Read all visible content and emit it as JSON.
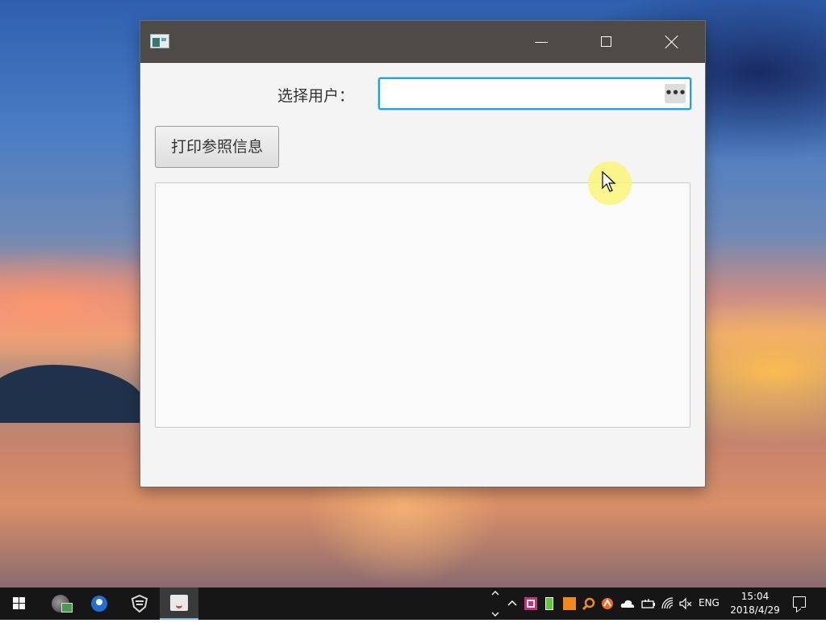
{
  "window": {
    "title": "",
    "controls": {
      "minimize": "minimize",
      "maximize": "maximize",
      "close": "close"
    }
  },
  "form": {
    "user_label": "选择用户：",
    "user_input_value": "",
    "browse_label": "•••",
    "print_button_label": "打印参照信息",
    "output_text": ""
  },
  "taskbar": {
    "language": "ENG",
    "time": "15:04",
    "date": "2018/4/29",
    "pinned_apps": [
      "image-viewer",
      "maps",
      "vpn-shield",
      "java-app"
    ],
    "tray_icons": [
      "show-hidden-icons",
      "network-app",
      "battery-app",
      "security-app",
      "search-app",
      "avast",
      "onedrive",
      "power",
      "wifi",
      "volume-muted"
    ]
  },
  "colors": {
    "titlebar": "#4e4a46",
    "input_focus_border": "#1fa3e0",
    "taskbar": "#161616"
  }
}
